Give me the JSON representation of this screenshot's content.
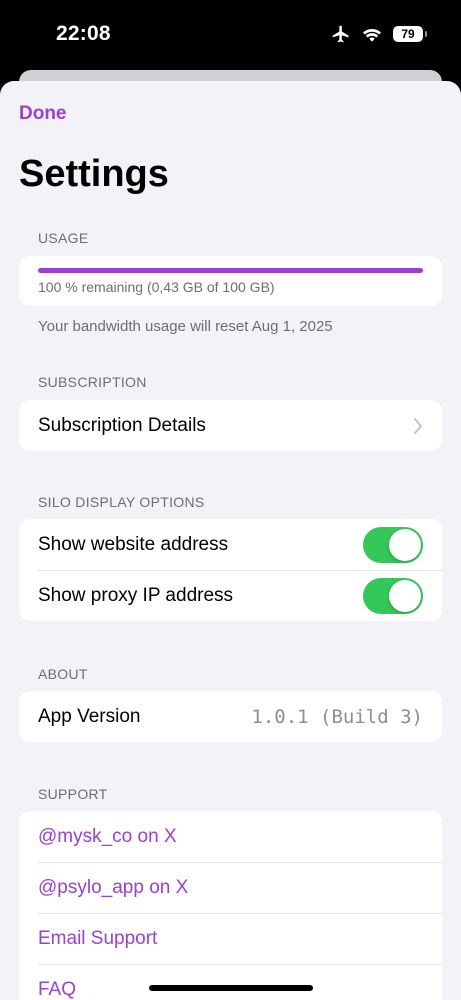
{
  "status_bar": {
    "time": "22:08",
    "battery": "79",
    "icons": [
      "airplane-icon",
      "wifi-icon",
      "battery-icon"
    ]
  },
  "nav": {
    "done_label": "Done",
    "title": "Settings"
  },
  "usage": {
    "header": "USAGE",
    "fraction_remaining": 1.0,
    "text": "100 % remaining (0,43 GB of 100 GB)",
    "footnote": "Your bandwidth usage will reset Aug 1, 2025"
  },
  "subscription": {
    "header": "SUBSCRIPTION",
    "details_label": "Subscription Details"
  },
  "display_options": {
    "header": "SILO DISPLAY OPTIONS",
    "items": [
      {
        "label": "Show website address",
        "on": true
      },
      {
        "label": "Show proxy IP address",
        "on": true
      }
    ]
  },
  "about": {
    "header": "ABOUT",
    "version_label": "App Version",
    "version_value": "1.0.1 (Build 3)"
  },
  "support": {
    "header": "SUPPORT",
    "items": [
      "@mysk_co on X",
      "@psylo_app on X",
      "Email Support",
      "FAQ"
    ]
  },
  "colors": {
    "accent": "#9a3fd8",
    "toggle_on": "#34c759",
    "background": "#f2f2f7"
  }
}
